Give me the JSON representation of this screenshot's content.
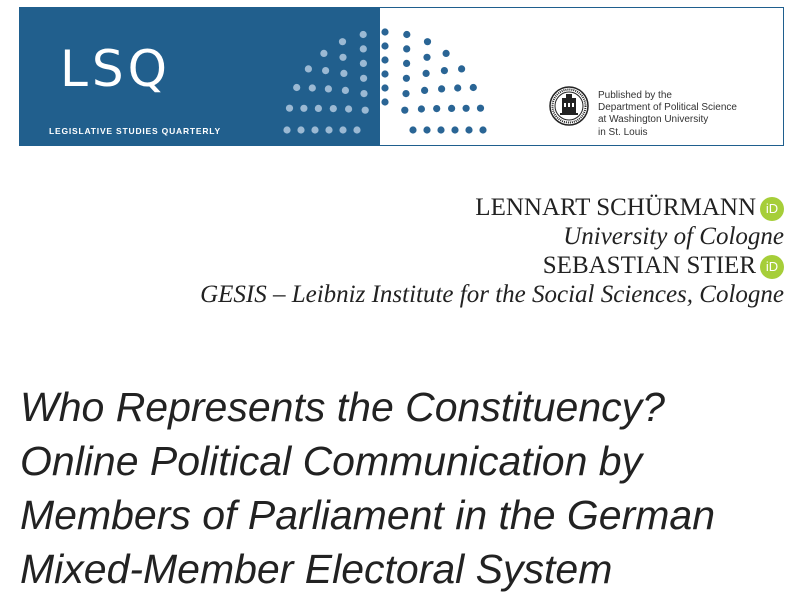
{
  "banner": {
    "logo": "LSQ",
    "subtitle": "LEGISLATIVE STUDIES QUARTERLY",
    "publisher_lines": [
      "Published by the",
      "Department of Political Science",
      "at Washington University",
      "in St. Louis"
    ],
    "colors": {
      "dark_blue": "#215f8d",
      "dot_blue": "#2a6595",
      "light_dot": "#9bb9d3"
    }
  },
  "authors": [
    {
      "name": "LENNART SCHÜRMANN",
      "icon": "orcid-icon",
      "affiliation": "University of Cologne"
    },
    {
      "name": "SEBASTIAN STIER",
      "icon": "orcid-icon",
      "affiliation": "GESIS – Leibniz Institute for the Social Sciences, Cologne"
    }
  ],
  "orcid_label": "iD",
  "title_lines": [
    "Who Represents the Constituency?",
    "Online Political Communication by",
    "Members of Parliament in the German",
    "Mixed-Member Electoral System"
  ]
}
